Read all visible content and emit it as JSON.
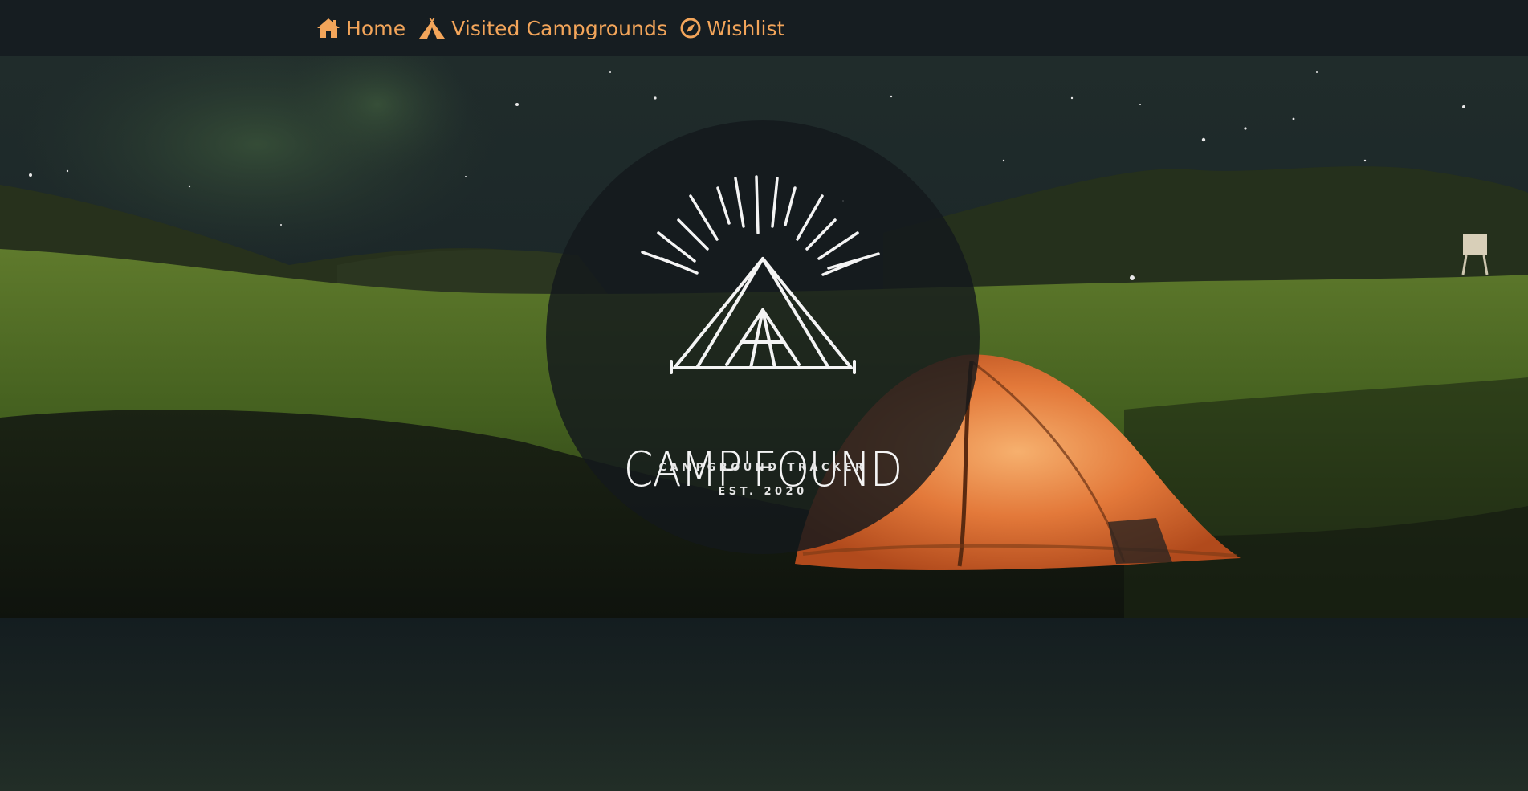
{
  "nav": {
    "items": [
      {
        "label": "Home",
        "icon": "home-icon"
      },
      {
        "label": "Visited Campgrounds",
        "icon": "tent-icon"
      },
      {
        "label": "Wishlist",
        "icon": "compass-icon"
      }
    ]
  },
  "logo": {
    "title": "CAMP'FOUND",
    "subtitle": "CAMPGROUND TRACKER",
    "established": "EST. 2020"
  },
  "colors": {
    "accent": "#f3a55a",
    "navbar": "#161d21",
    "logo_text": "#f4f4f4"
  }
}
